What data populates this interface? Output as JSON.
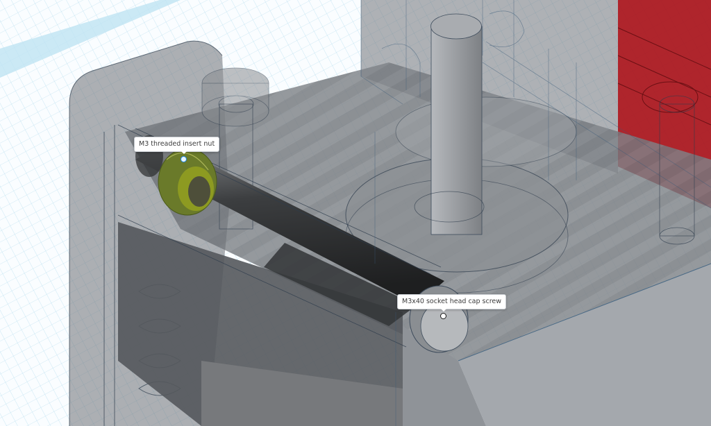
{
  "viewport": {
    "grid_color": "#a9d8ec",
    "body_color": "#6c7075",
    "highlight_color": "#9aa61f",
    "mount_color": "#b3121a"
  },
  "callouts": [
    {
      "label": "M3 threaded insert nut",
      "icon": "anchor-dot-icon",
      "selected": true
    },
    {
      "label": "M3x40 socket head cap screw",
      "icon": "anchor-dot-icon",
      "selected": false
    }
  ]
}
